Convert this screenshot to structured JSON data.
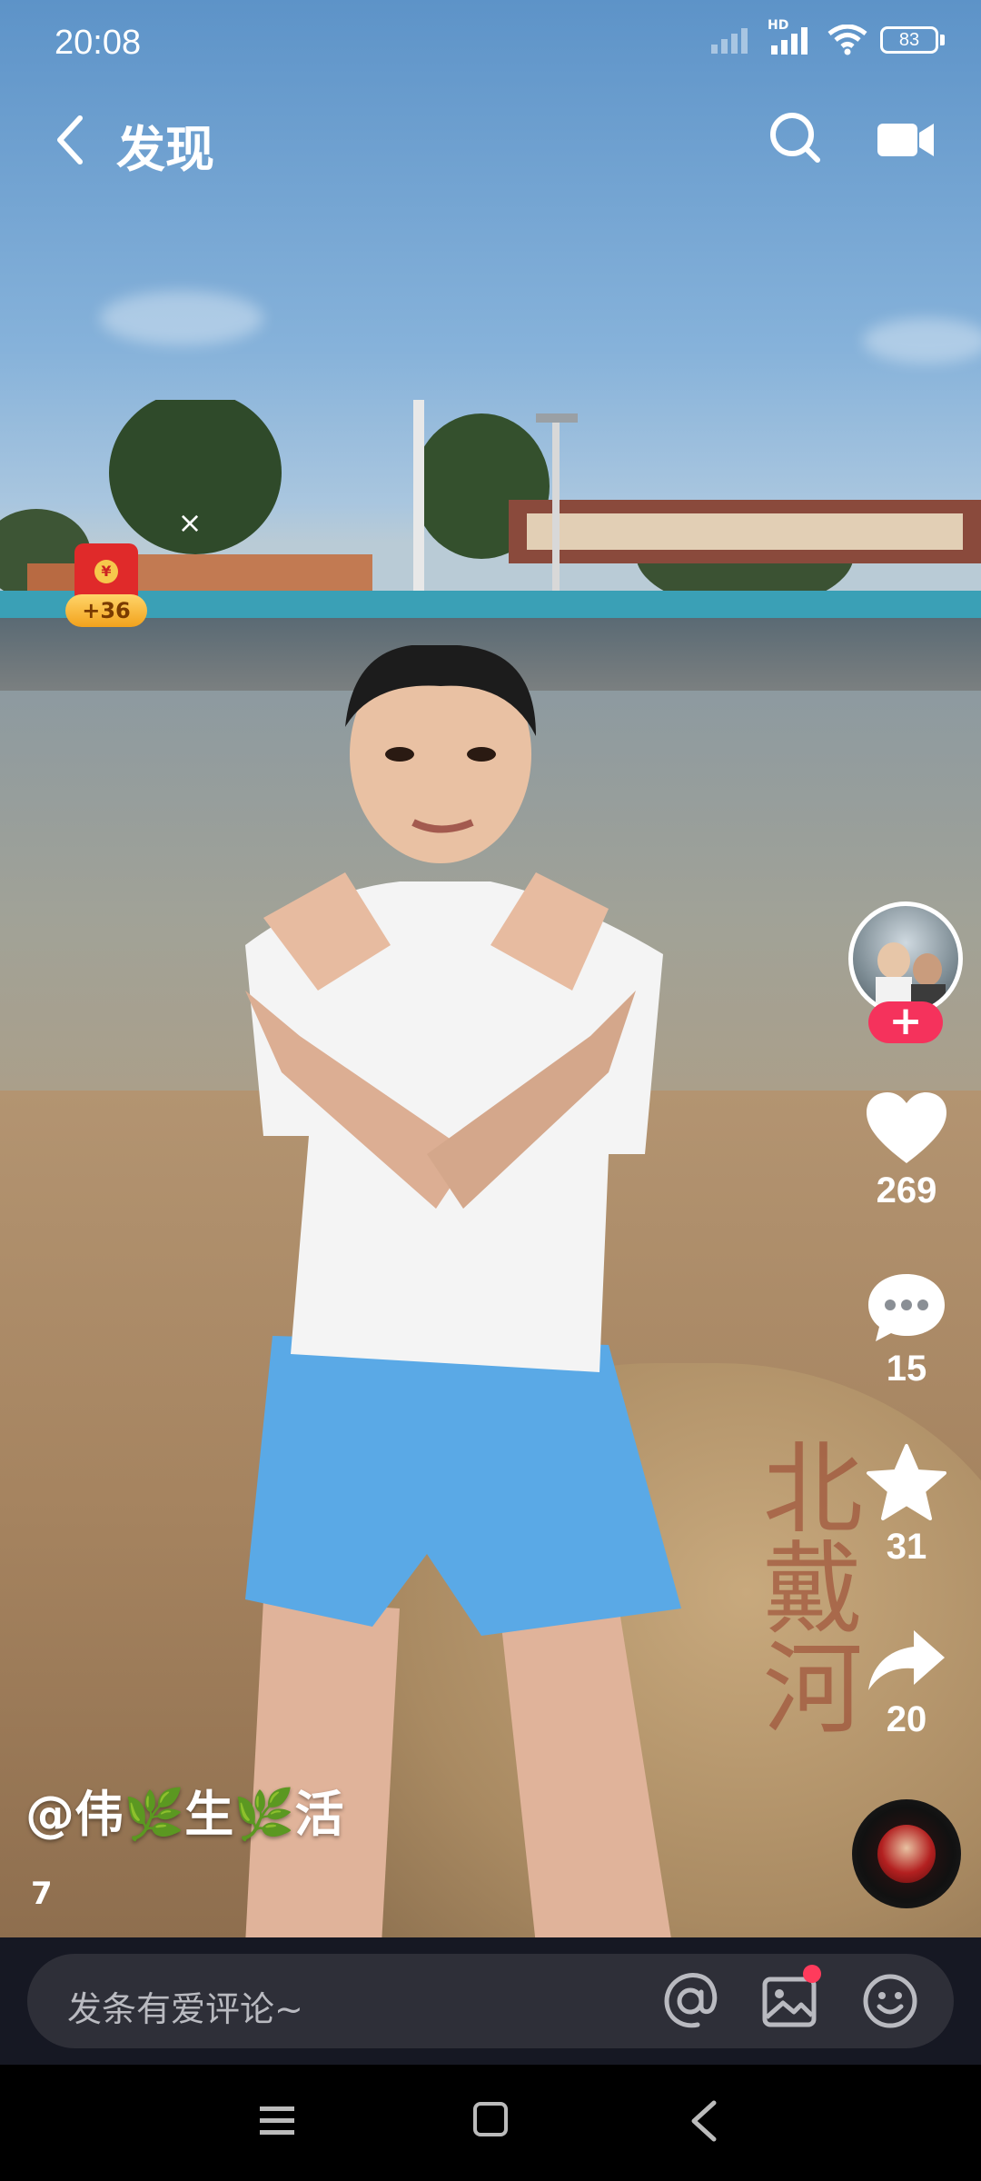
{
  "status_bar": {
    "time": "20:08",
    "network": "HD",
    "battery": "83"
  },
  "top_nav": {
    "title": "发现",
    "back_icon": "chevron-left-icon",
    "search_icon": "search-icon",
    "camera_icon": "video-camera-icon"
  },
  "red_packet": {
    "close": "×",
    "coin_symbol": "¥",
    "bonus": "+36"
  },
  "video": {
    "rock_inscription": "北戴河"
  },
  "actions": {
    "follow_label": "+",
    "likes": "269",
    "comments": "15",
    "favorites": "31",
    "shares": "20"
  },
  "author": {
    "handle": "@伟🌿生🌿活",
    "desc": "7"
  },
  "comment_bar": {
    "placeholder": "发条有爱评论~"
  },
  "colors": {
    "accent": "#f5325c",
    "comment_bar_bg": "#2e2f38",
    "comment_area_bg": "#161823"
  }
}
